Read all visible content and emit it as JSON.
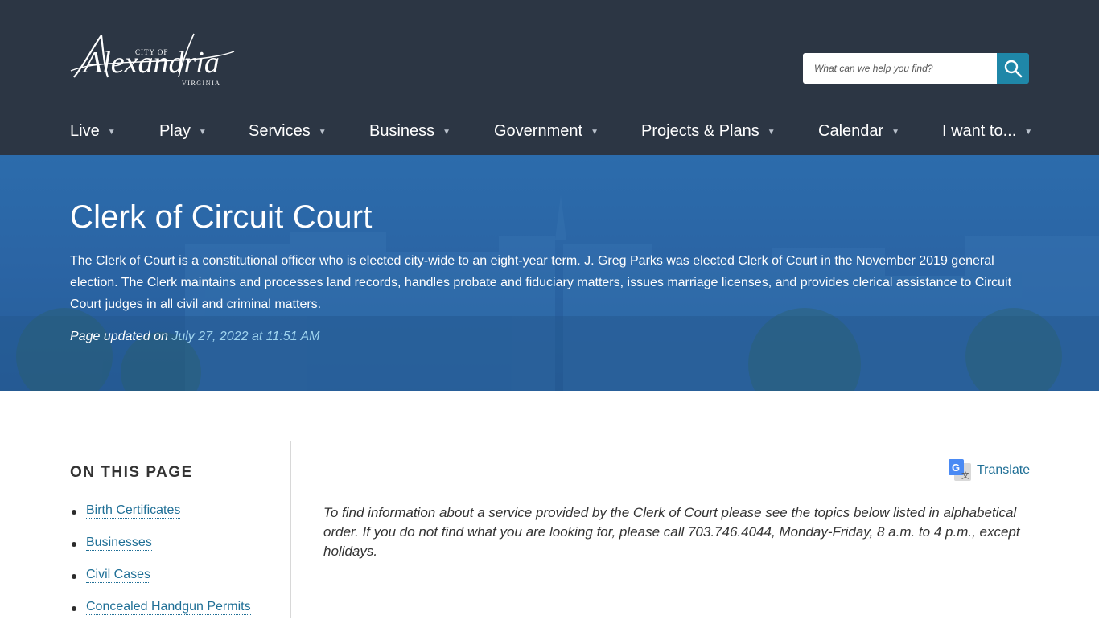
{
  "header": {
    "logo": {
      "city_of": "CITY OF",
      "name": "Alexandria",
      "state": "VIRGINIA"
    },
    "search": {
      "placeholder": "What can we help you find?",
      "icon": "search-icon"
    },
    "nav": [
      {
        "label": "Live"
      },
      {
        "label": "Play"
      },
      {
        "label": "Services"
      },
      {
        "label": "Business"
      },
      {
        "label": "Government"
      },
      {
        "label": "Projects & Plans"
      },
      {
        "label": "Calendar"
      },
      {
        "label": "I want to..."
      }
    ],
    "colors": {
      "background": "#2c3644",
      "search_button": "#1f87a8"
    }
  },
  "hero": {
    "title": "Clerk of Circuit Court",
    "description": "The Clerk of Court is a constitutional officer who is elected city-wide to an eight-year term. J. Greg Parks was elected Clerk of Court in the November 2019 general election. The Clerk maintains and processes land records, handles probate and fiduciary matters, issues marriage licenses, and provides clerical assistance to Circuit Court judges in all civil and criminal matters.",
    "updated_prefix": "Page updated on",
    "updated_date": "July 27, 2022 at 11:51 AM"
  },
  "sidebar": {
    "heading": "ON THIS PAGE",
    "items": [
      {
        "label": "Birth Certificates"
      },
      {
        "label": "Businesses"
      },
      {
        "label": "Civil Cases"
      },
      {
        "label": "Concealed Handgun Permits"
      }
    ]
  },
  "main": {
    "translate_label": "Translate",
    "translate_icon": "google-translate-icon",
    "intro": "To find information about a service provided by the Clerk of Court please see the topics below listed in alphabetical order.  If you do not find what you are looking for, please call 703.746.4044, Monday-Friday, 8 a.m. to 4 p.m., except holidays."
  }
}
